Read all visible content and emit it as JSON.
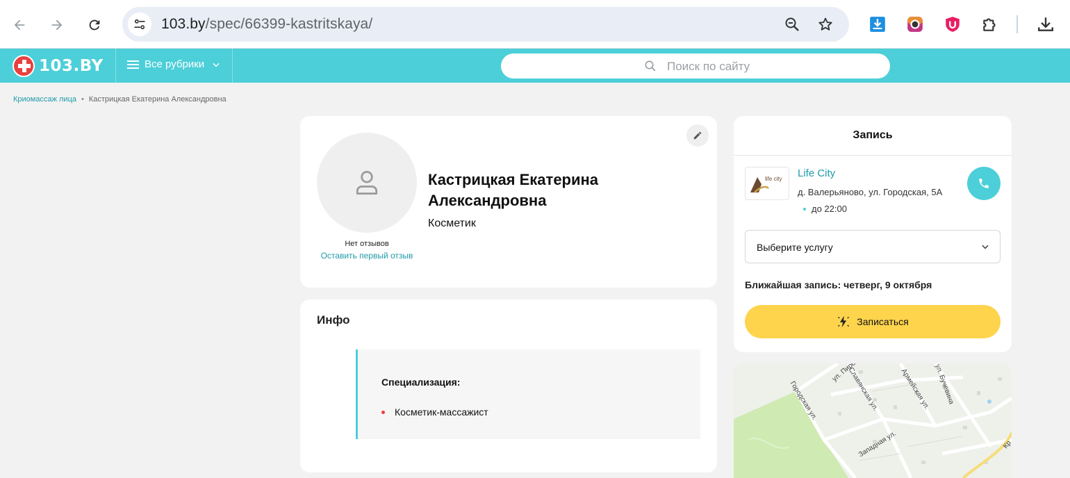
{
  "browser": {
    "url_host": "103.by",
    "url_path": "/spec/66399-kastritskaya/",
    "icons": [
      "back-icon",
      "forward-icon",
      "reload-icon",
      "site-settings-icon",
      "zoom-icon",
      "bookmark-star-icon",
      "download-extension-icon",
      "camera-extension-icon",
      "shield-extension-icon",
      "puzzle-icon",
      "downloads-icon"
    ]
  },
  "header": {
    "logo_text": "103.BY",
    "rubrics_label": "Все рубрики",
    "search_placeholder": "Поиск по сайту",
    "accent_color": "#4ccfd8"
  },
  "breadcrumb": {
    "items": [
      "Криомассаж лица",
      "Кастрицкая Екатерина Александровна"
    ]
  },
  "profile": {
    "name": "Кастрицкая Екатерина Александровна",
    "role": "Косметик",
    "reviews_status": "Нет отзывов",
    "leave_review": "Оставить первый отзыв"
  },
  "info": {
    "title": "Инфо",
    "specialization_label": "Специализация:",
    "specializations": [
      "Косметик-массажист"
    ]
  },
  "booking": {
    "title": "Запись",
    "clinic_name": "Life City",
    "clinic_logo_text": "life city",
    "clinic_address": "д. Валерьяново, ул. Городская, 5А",
    "clinic_hours": "до 22:00",
    "service_placeholder": "Выберите услугу",
    "nearest_slot": "Ближайшая запись: четверг, 9 октября",
    "book_button": "Записаться",
    "button_color": "#ffd44d"
  },
  "map": {
    "streets": [
      "ул. Пирогова",
      "Славянская ул.",
      "Армейская ул.",
      "ул. Бучевина",
      "Городская ул.",
      "Западная ул.",
      "Кр"
    ]
  }
}
